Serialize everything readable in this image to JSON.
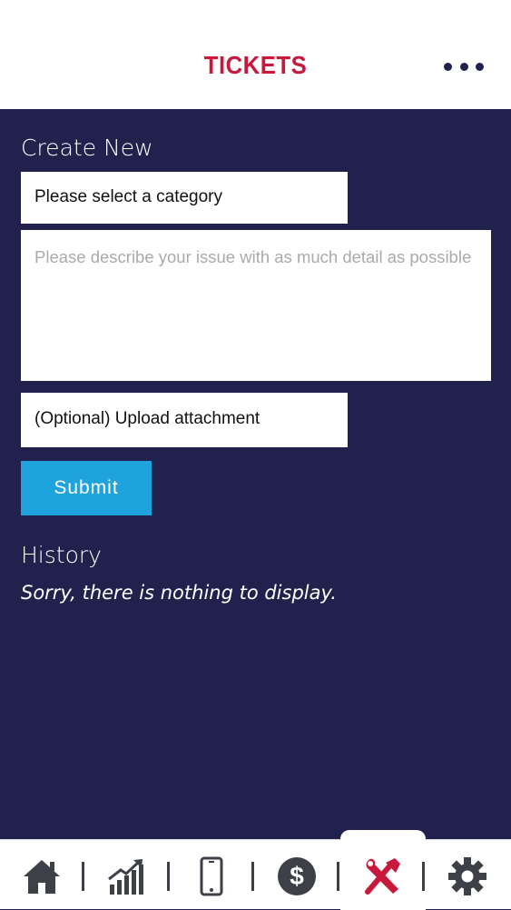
{
  "header": {
    "title": "TICKETS",
    "accent_color": "#c8193c",
    "menu_icon": "more-horizontal-icon"
  },
  "create": {
    "heading": "Create New",
    "category_placeholder": "Please select a category",
    "description_placeholder": "Please describe your issue with as much detail as possible",
    "upload_label": "(Optional) Upload attachment",
    "submit_label": "Submit",
    "submit_color": "#1fa3dd"
  },
  "history": {
    "heading": "History",
    "empty_message": "Sorry, there is nothing to display."
  },
  "nav": {
    "items": [
      {
        "icon": "home-icon",
        "active": false
      },
      {
        "icon": "growth-chart-icon",
        "active": false
      },
      {
        "icon": "mobile-phone-icon",
        "active": false
      },
      {
        "icon": "dollar-icon",
        "active": false
      },
      {
        "icon": "tools-icon",
        "active": true
      },
      {
        "icon": "gear-icon",
        "active": false
      }
    ],
    "active_color": "#c8193c",
    "inactive_color": "#3d4147"
  },
  "colors": {
    "background": "#20224d"
  }
}
